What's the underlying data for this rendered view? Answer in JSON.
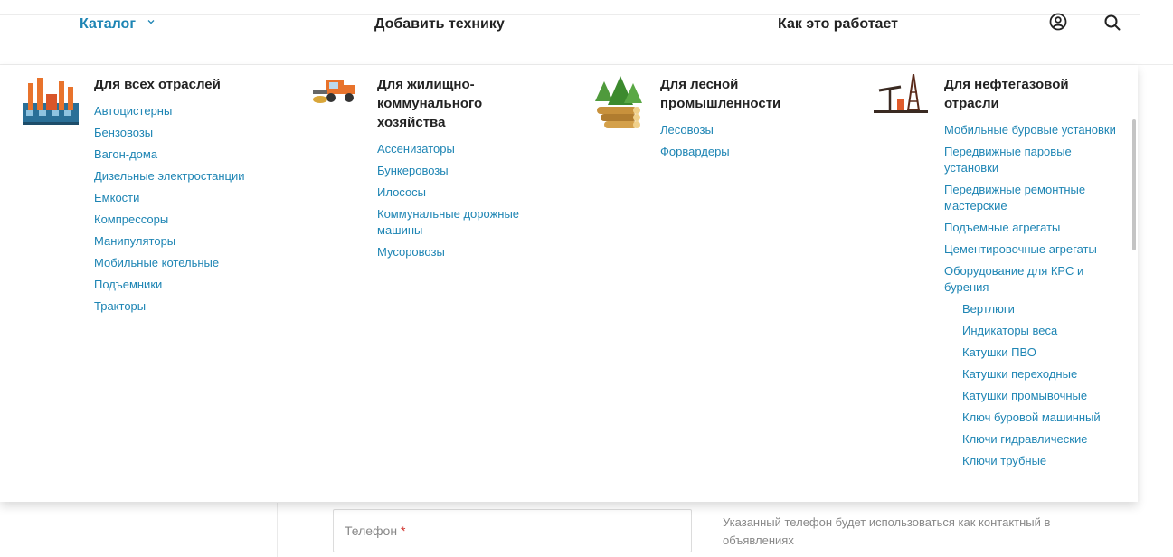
{
  "header": {
    "catalog": "Каталог",
    "add_equipment": "Добавить технику",
    "how_it_works": "Как это работает"
  },
  "form": {
    "phone_label": "Телефон",
    "phone_required_mark": "*",
    "phone_hint": "Указанный телефон будет использоваться как контактный в объявлениях"
  },
  "menu": {
    "columns": [
      {
        "title": "Для всех отраслей",
        "icon": "factory-icon",
        "items": [
          "Автоцистерны",
          "Бензовозы",
          "Вагон-дома",
          "Дизельные электростанции",
          "Емкости",
          "Компрессоры",
          "Манипуляторы",
          "Мобильные котельные",
          "Подъемники",
          "Тракторы"
        ]
      },
      {
        "title": "Для жилищно-коммунального хозяйства",
        "icon": "street-sweeper-icon",
        "items": [
          "Ассенизаторы",
          "Бункеровозы",
          "Илососы",
          "Коммунальные дорожные машины",
          "Мусоровозы"
        ]
      },
      {
        "title": "Для лесной промышленности",
        "icon": "forest-logs-icon",
        "items": [
          "Лесовозы",
          "Форвардеры"
        ]
      },
      {
        "title": "Для нефтегазовой отрасли",
        "icon": "oil-rig-icon",
        "items": [
          "Мобильные буровые установки",
          "Передвижные паровые установки",
          "Передвижные ремонтные мастерские",
          "Подъемные агрегаты",
          "Цементировочные агрегаты",
          "Оборудование для КРС и бурения"
        ],
        "subitems": [
          "Вертлюги",
          "Индикаторы веса",
          "Катушки ПВО",
          "Катушки переходные",
          "Катушки промывочные",
          "Ключ буровой машинный",
          "Ключи гидравлические",
          "Ключи трубные"
        ]
      }
    ]
  },
  "colors": {
    "link": "#1e85b4",
    "text": "#222222",
    "required": "#d0302a"
  }
}
